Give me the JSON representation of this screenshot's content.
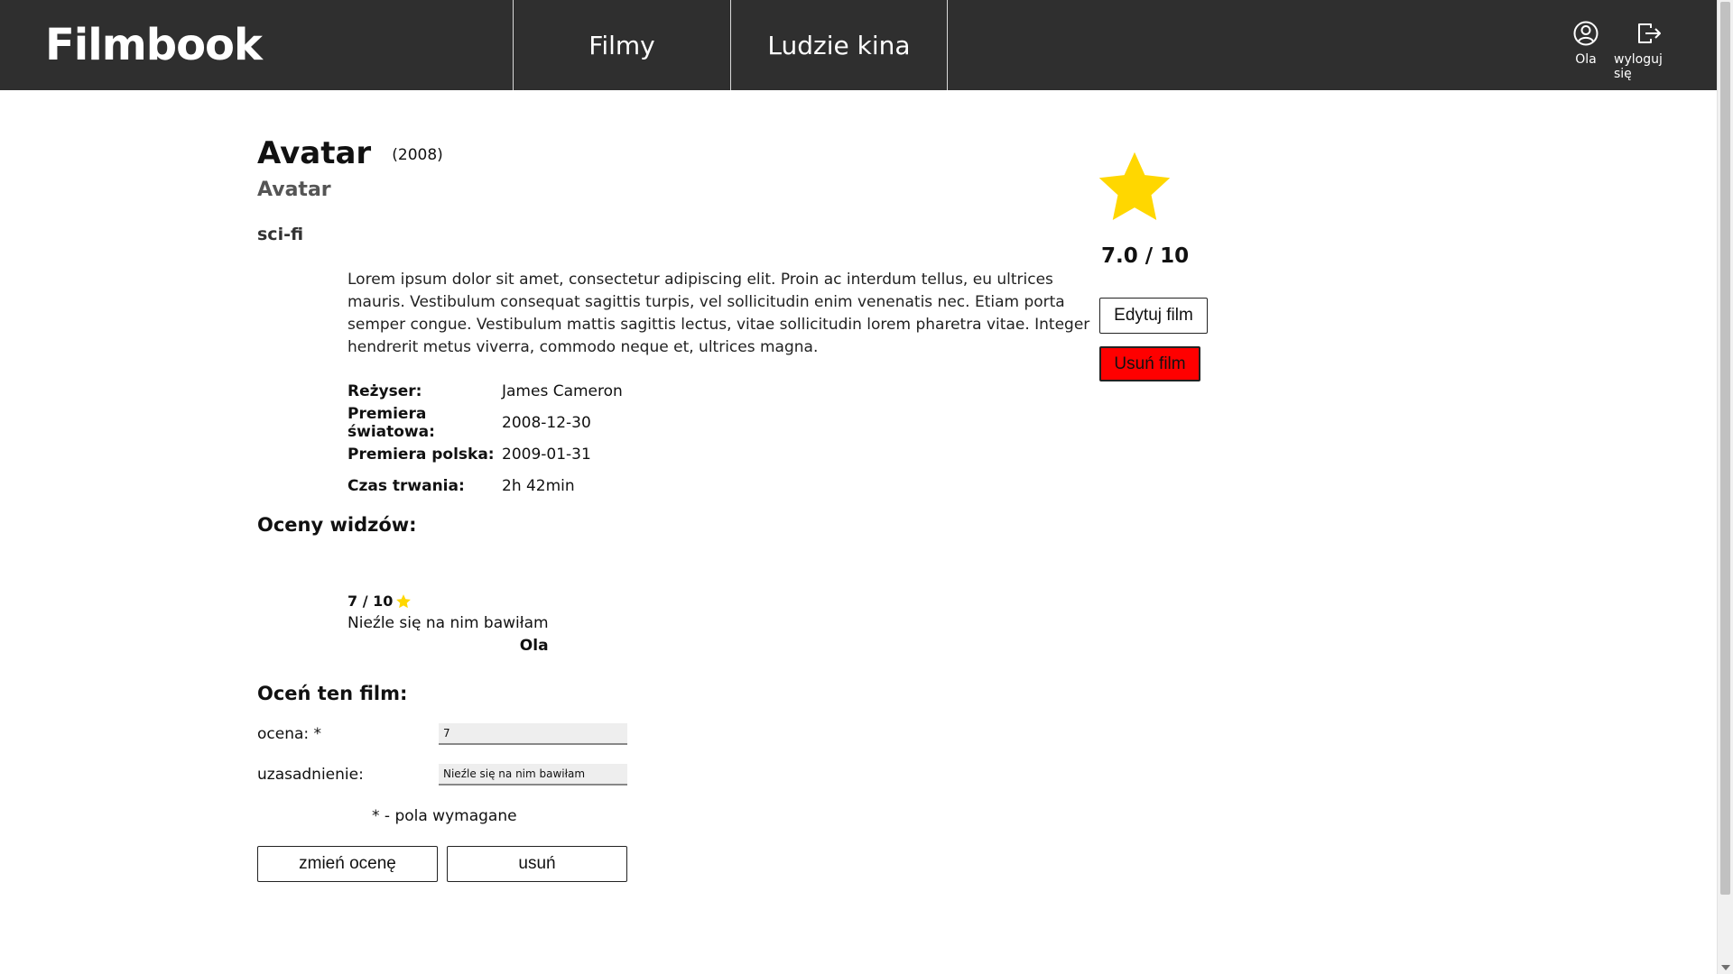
{
  "header": {
    "logo": "Filmbook",
    "nav": [
      {
        "label": "Filmy"
      },
      {
        "label": "Ludzie kina"
      }
    ],
    "user": {
      "label": "Ola",
      "icon": "user-circle-icon"
    },
    "logout": {
      "label": "wyloguj się",
      "icon": "logout-icon"
    }
  },
  "film": {
    "title": "Avatar",
    "year": "(2008)",
    "original_title": "Avatar",
    "genre": "sci-fi",
    "description": "Lorem ipsum dolor sit amet, consectetur adipiscing elit. Proin ac interdum tellus, eu ultrices mauris. Vestibulum consequat sagittis turpis, vel sollicitudin enim venenatis nec. Etiam porta semper congue. Vestibulum mattis sagittis lectus, vitae sollicitudin lorem pharetra vitae. Integer hendrerit metus viverra, commodo neque et, ultrices magna.",
    "details": [
      {
        "label": "Reżyser:",
        "value": "James Cameron"
      },
      {
        "label": "Premiera światowa:",
        "value": "2008-12-30"
      },
      {
        "label": "Premiera polska:",
        "value": "2009-01-31"
      },
      {
        "label": "Czas trwania:",
        "value": "2h 42min"
      }
    ],
    "average_rating": "7.0 / 10",
    "star_color": "#FFD700"
  },
  "actions": {
    "edit_film": "Edytuj film",
    "delete_film": "Usuń film",
    "delete_color": "#FF0000"
  },
  "ratings": {
    "heading": "Oceny widzów:",
    "items": [
      {
        "score": "7 / 10",
        "text": "Nieźle się na nim bawiłam",
        "author": "Ola"
      }
    ]
  },
  "rate_form": {
    "heading": "Oceń ten film:",
    "score_label": "ocena: *",
    "score_value": "7",
    "reason_label": "uzasadnienie:",
    "reason_value": "Nieźle się na nim bawiłam",
    "required_note": "* - pola wymagane",
    "change_button": "zmień ocenę",
    "delete_button": "usuń"
  }
}
